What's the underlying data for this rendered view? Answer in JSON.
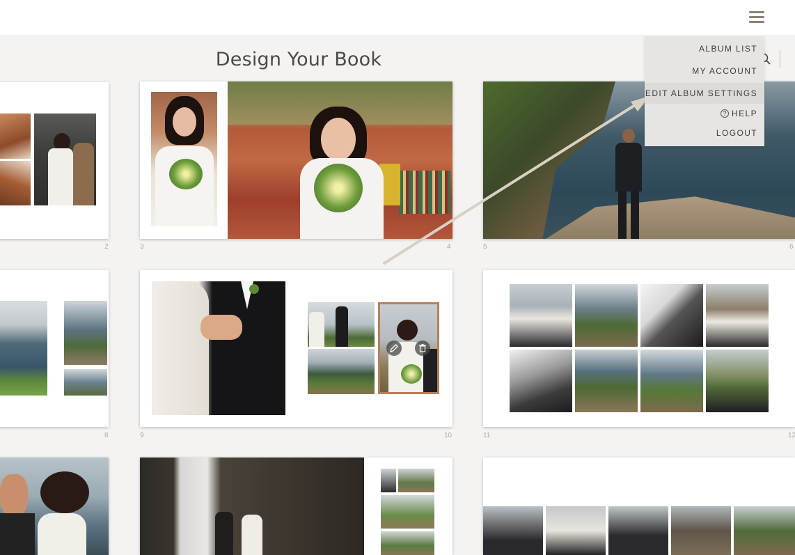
{
  "header": {
    "page_title": "Design Your Book",
    "menu_icon": "hamburger-menu-icon",
    "search_icon": "search-icon"
  },
  "menu": {
    "items": [
      {
        "label": "ALBUM LIST"
      },
      {
        "label": "MY ACCOUNT"
      },
      {
        "label": "EDIT ALBUM SETTINGS"
      },
      {
        "label": "HELP",
        "icon": "help-circle-icon"
      },
      {
        "label": "LOGOUT"
      }
    ]
  },
  "page_numbers": {
    "p2": "2",
    "p3": "3",
    "p4": "4",
    "p5": "5",
    "p6": "6",
    "p8": "8",
    "p9": "9",
    "p10": "10",
    "p11": "11",
    "p12": "12"
  },
  "colors": {
    "accent": "#b5805f",
    "menu_bg": "#e6e5e3",
    "menu_highlight": "#dcdbd8",
    "page_bg": "#f4f3f1",
    "arrow": "#d9d0c4"
  }
}
